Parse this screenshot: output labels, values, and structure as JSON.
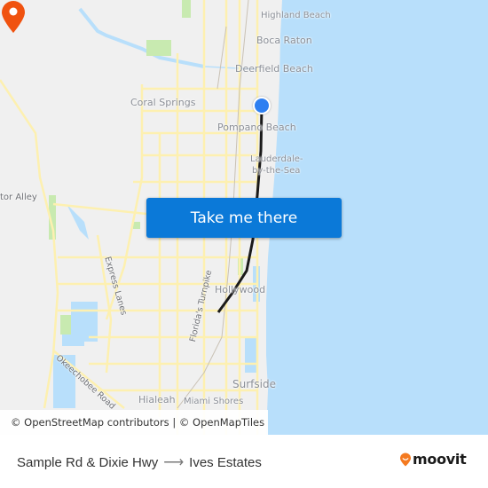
{
  "map": {
    "colors": {
      "land": "#f0f0f0",
      "water": "#b8dffb",
      "road": "#fdf0b0",
      "park": "#c8eab0",
      "route": "#1a1a1a",
      "origin": "#2e7ff1",
      "destination": "#f0520f",
      "button": "#0b79d8",
      "brand": "#f47a20"
    },
    "places": {
      "highland_beach": "Highland Beach",
      "boca_raton": "Boca Raton",
      "deerfield_beach": "Deerfield Beach",
      "coral_springs": "Coral Springs",
      "pompano_beach": "Pompano Beach",
      "lauderdale_1": "Lauderdale-",
      "lauderdale_2": "by-the-Sea",
      "alligator_alley": "tor Alley",
      "hollywood": "Hollywood",
      "surfside": "Surfside",
      "hialeah": "Hialeah",
      "miami_shores": "Miami Shores"
    },
    "roads": {
      "express_lanes": "Express Lanes",
      "floridas_turnpike": "Florida's Turnpike",
      "okeechobee_road": "Okeechobee Road"
    },
    "origin_icon": "origin-dot-icon",
    "destination_icon": "destination-pin-icon"
  },
  "cta": {
    "label": "Take me there"
  },
  "attribution": {
    "text": "© OpenStreetMap contributors | © OpenMapTiles"
  },
  "footer": {
    "origin": "Sample Rd & Dixie Hwy",
    "arrow": "⟶",
    "destination": "Ives Estates",
    "logo_text": "moovit"
  }
}
